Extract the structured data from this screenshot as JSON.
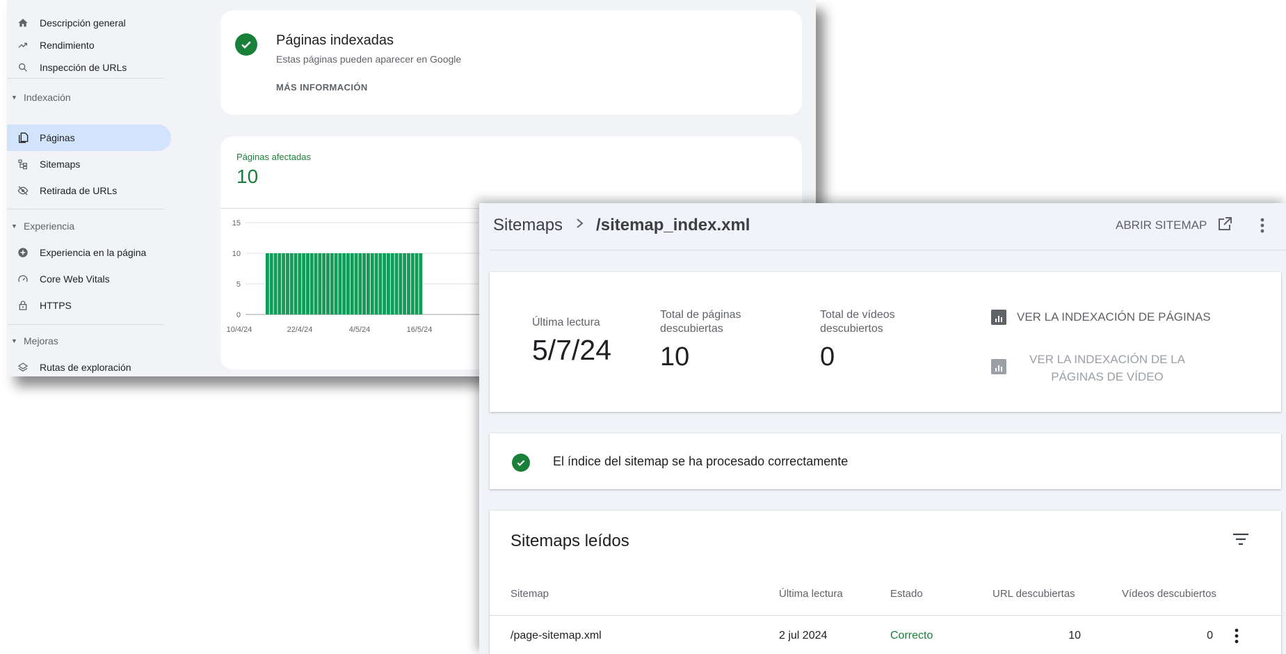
{
  "sidebar": {
    "top_items": [
      {
        "label": "Descripción general",
        "icon": "home-icon"
      },
      {
        "label": "Rendimiento",
        "icon": "trending-up-icon"
      },
      {
        "label": "Inspección de URLs",
        "icon": "search-icon"
      }
    ],
    "sections": [
      {
        "title": "Indexación",
        "items": [
          {
            "label": "Páginas",
            "icon": "pages-icon",
            "active": true
          },
          {
            "label": "Sitemaps",
            "icon": "sitemap-icon"
          },
          {
            "label": "Retirada de URLs",
            "icon": "visibility-off-icon"
          }
        ]
      },
      {
        "title": "Experiencia",
        "items": [
          {
            "label": "Experiencia en la página",
            "icon": "add-circle-icon"
          },
          {
            "label": "Core Web Vitals",
            "icon": "speed-icon"
          },
          {
            "label": "HTTPS",
            "icon": "lock-icon"
          }
        ]
      },
      {
        "title": "Mejoras",
        "items": [
          {
            "label": "Rutas de exploración",
            "icon": "layers-icon"
          }
        ]
      }
    ]
  },
  "indexed": {
    "title": "Páginas indexadas",
    "subtitle": "Estas páginas pueden aparecer en Google",
    "more_info": "MÁS INFORMACIÓN"
  },
  "affected": {
    "label": "Páginas afectadas",
    "count": "10"
  },
  "chart_data": {
    "type": "bar",
    "ylim": [
      0,
      15
    ],
    "yticks": [
      0,
      5,
      10,
      15
    ],
    "xtick_labels": [
      "10/4/24",
      "22/4/24",
      "4/5/24",
      "16/5/24"
    ],
    "values": [
      10,
      10,
      10,
      10,
      10,
      10,
      10,
      10,
      10,
      10,
      10,
      10,
      10,
      10,
      10,
      10,
      10,
      10,
      10,
      10,
      10,
      10,
      10,
      10,
      10,
      10,
      10,
      10,
      10,
      10,
      10,
      10,
      10,
      10,
      10,
      10,
      10,
      10,
      10
    ],
    "bar_color": "#0f9d58",
    "grid": true
  },
  "sitemap_detail": {
    "breadcrumb_root": "Sitemaps",
    "breadcrumb_current": "/sitemap_index.xml",
    "open_label": "ABRIR SITEMAP",
    "stats": {
      "last_read_label": "Última lectura",
      "last_read_value": "5/7/24",
      "pages_label_1": "Total de páginas",
      "pages_label_2": "descubiertas",
      "pages_value": "10",
      "videos_label_1": "Total de vídeos",
      "videos_label_2": "descubiertos",
      "videos_value": "0"
    },
    "link_pages": "VER LA INDEXACIÓN DE PÁGINAS",
    "link_videos_1": "VER LA INDEXACIÓN DE LA",
    "link_videos_2": "PÁGINAS DE VÍDEO",
    "status_message": "El índice del sitemap se ha procesado correctamente",
    "table": {
      "title": "Sitemaps leídos",
      "headers": [
        "Sitemap",
        "Última lectura",
        "Estado",
        "URL descubiertas",
        "Vídeos descubiertos"
      ],
      "rows": [
        {
          "sitemap": "/page-sitemap.xml",
          "last_read": "2 jul 2024",
          "status": "Correcto",
          "urls": "10",
          "videos": "0"
        }
      ]
    },
    "colors": {
      "success": "#188038",
      "link": "#5f6368",
      "disabled": "#9aa0a6"
    }
  }
}
